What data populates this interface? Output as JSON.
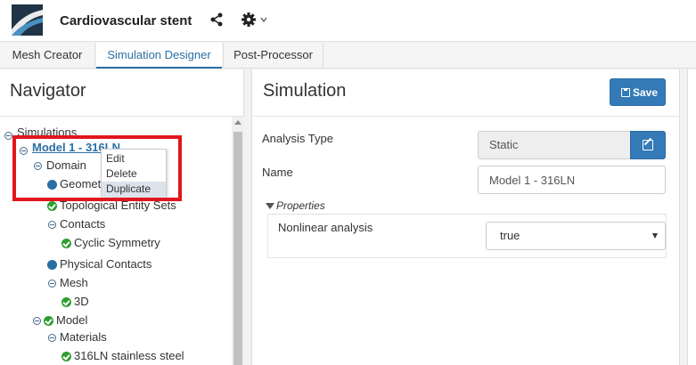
{
  "app": {
    "title": "Cardiovascular stent"
  },
  "tabs": [
    {
      "label": "Mesh Creator"
    },
    {
      "label": "Simulation Designer"
    },
    {
      "label": "Post-Processor"
    }
  ],
  "navigator": {
    "title": "Navigator",
    "tree": {
      "root": "Simulations",
      "model": "Model 1 - 316LN",
      "domain": "Domain",
      "geometry": "Geomet",
      "topological": "Topological Entity Sets",
      "contacts": "Contacts",
      "cyclic": "Cyclic Symmetry",
      "physical_contacts": "Physical Contacts",
      "mesh": "Mesh",
      "mesh_3d": "3D",
      "model_node": "Model",
      "materials": "Materials",
      "steel": "316LN stainless steel"
    },
    "context_menu": {
      "items": [
        "Edit",
        "Delete",
        "Duplicate"
      ],
      "active": "Duplicate"
    }
  },
  "simulation": {
    "title": "Simulation",
    "save_label": "Save",
    "analysis_type_label": "Analysis Type",
    "analysis_type_value": "Static",
    "name_label": "Name",
    "name_value": "Model 1 - 316LN",
    "properties_label": "Properties",
    "nonlinear_label": "Nonlinear analysis",
    "nonlinear_value": "true"
  },
  "colors": {
    "accent": "#337ab7",
    "highlight": "#e2161e",
    "success": "#2e9e2e"
  }
}
